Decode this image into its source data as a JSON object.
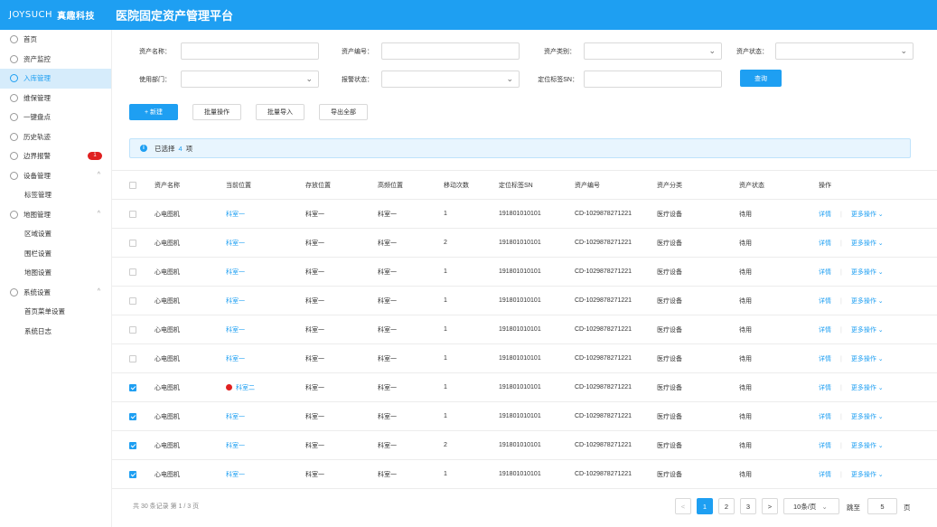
{
  "header": {
    "brand": "JOYSUCH",
    "brand_cn": "真趣科技",
    "title": "医院固定资产管理平台"
  },
  "sidebar": {
    "items": [
      {
        "label": "首页",
        "icon": "home-icon"
      },
      {
        "label": "资产监控",
        "icon": "monitor-icon"
      },
      {
        "label": "入库管理",
        "icon": "inbound-icon",
        "active": true
      },
      {
        "label": "维保管理",
        "icon": "maintenance-icon"
      },
      {
        "label": "一键盘点",
        "icon": "inventory-icon"
      },
      {
        "label": "历史轨迹",
        "icon": "history-icon"
      },
      {
        "label": "边界报警",
        "icon": "alarm-icon",
        "badge": "1"
      },
      {
        "label": "设备管理",
        "icon": "device-icon",
        "expanded": true
      },
      {
        "label": "标签管理",
        "sub": true
      },
      {
        "label": "地图管理",
        "icon": "map-icon",
        "expanded": true
      },
      {
        "label": "区域设置",
        "sub": true
      },
      {
        "label": "围栏设置",
        "sub": true
      },
      {
        "label": "地图设置",
        "sub": true
      },
      {
        "label": "系统设置",
        "icon": "settings-icon",
        "expanded": true
      },
      {
        "label": "首页菜单设置",
        "sub": true
      },
      {
        "label": "系统日志",
        "sub": true
      }
    ]
  },
  "filters": {
    "asset_name": "资产名称：",
    "asset_no": "资产编号：",
    "asset_type": "资产类别：",
    "asset_status": "资产状态：",
    "dept": "使用部门：",
    "alarm_status": "报警状态：",
    "tag_sn": "定位标签SN：",
    "query": "查询"
  },
  "actions": {
    "create": "+ 新建",
    "batch_op": "批量操作",
    "batch_import": "批量导入",
    "export_all": "导出全部"
  },
  "info": {
    "prefix": "已选择",
    "count": "4",
    "suffix": "项"
  },
  "table": {
    "headers": [
      "资产名称",
      "当前位置",
      "存放位置",
      "高频位置",
      "移动次数",
      "定位标签SN",
      "资产编号",
      "资产分类",
      "资产状态",
      "操作"
    ],
    "detail_label": "详情",
    "more_label": "更多操作",
    "rows": [
      {
        "name": "心电图机",
        "cur": "科室一",
        "store": "科室一",
        "freq": "科室一",
        "moves": "1",
        "sn": "191801010101",
        "no": "CD-1029878271221",
        "cat": "医疗设备",
        "status": "待用",
        "checked": false,
        "alarm": false
      },
      {
        "name": "心电图机",
        "cur": "科室一",
        "store": "科室一",
        "freq": "科室一",
        "moves": "2",
        "sn": "191801010101",
        "no": "CD-1029878271221",
        "cat": "医疗设备",
        "status": "待用",
        "checked": false,
        "alarm": false
      },
      {
        "name": "心电图机",
        "cur": "科室一",
        "store": "科室一",
        "freq": "科室一",
        "moves": "1",
        "sn": "191801010101",
        "no": "CD-1029878271221",
        "cat": "医疗设备",
        "status": "待用",
        "checked": false,
        "alarm": false
      },
      {
        "name": "心电图机",
        "cur": "科室一",
        "store": "科室一",
        "freq": "科室一",
        "moves": "1",
        "sn": "191801010101",
        "no": "CD-1029878271221",
        "cat": "医疗设备",
        "status": "待用",
        "checked": false,
        "alarm": false
      },
      {
        "name": "心电图机",
        "cur": "科室一",
        "store": "科室一",
        "freq": "科室一",
        "moves": "1",
        "sn": "191801010101",
        "no": "CD-1029878271221",
        "cat": "医疗设备",
        "status": "待用",
        "checked": false,
        "alarm": false
      },
      {
        "name": "心电图机",
        "cur": "科室一",
        "store": "科室一",
        "freq": "科室一",
        "moves": "1",
        "sn": "191801010101",
        "no": "CD-1029878271221",
        "cat": "医疗设备",
        "status": "待用",
        "checked": false,
        "alarm": false
      },
      {
        "name": "心电图机",
        "cur": "科室二",
        "store": "科室一",
        "freq": "科室一",
        "moves": "1",
        "sn": "191801010101",
        "no": "CD-1029878271221",
        "cat": "医疗设备",
        "status": "待用",
        "checked": true,
        "alarm": true
      },
      {
        "name": "心电图机",
        "cur": "科室一",
        "store": "科室一",
        "freq": "科室一",
        "moves": "1",
        "sn": "191801010101",
        "no": "CD-1029878271221",
        "cat": "医疗设备",
        "status": "待用",
        "checked": true,
        "alarm": false
      },
      {
        "name": "心电图机",
        "cur": "科室一",
        "store": "科室一",
        "freq": "科室一",
        "moves": "2",
        "sn": "191801010101",
        "no": "CD-1029878271221",
        "cat": "医疗设备",
        "status": "待用",
        "checked": true,
        "alarm": false
      },
      {
        "name": "心电图机",
        "cur": "科室一",
        "store": "科室一",
        "freq": "科室一",
        "moves": "1",
        "sn": "191801010101",
        "no": "CD-1029878271221",
        "cat": "医疗设备",
        "status": "待用",
        "checked": true,
        "alarm": false
      }
    ]
  },
  "pagination": {
    "summary": "共 30 条记录 第 1 / 3 页",
    "prev": "<",
    "next": ">",
    "pages": [
      "1",
      "2",
      "3"
    ],
    "current": "1",
    "page_size": "10条/页",
    "jump_label": "跳至",
    "jump_value": "5",
    "page_unit": "页"
  },
  "colors": {
    "primary": "#1e9ff2",
    "alarm": "#e02020"
  }
}
